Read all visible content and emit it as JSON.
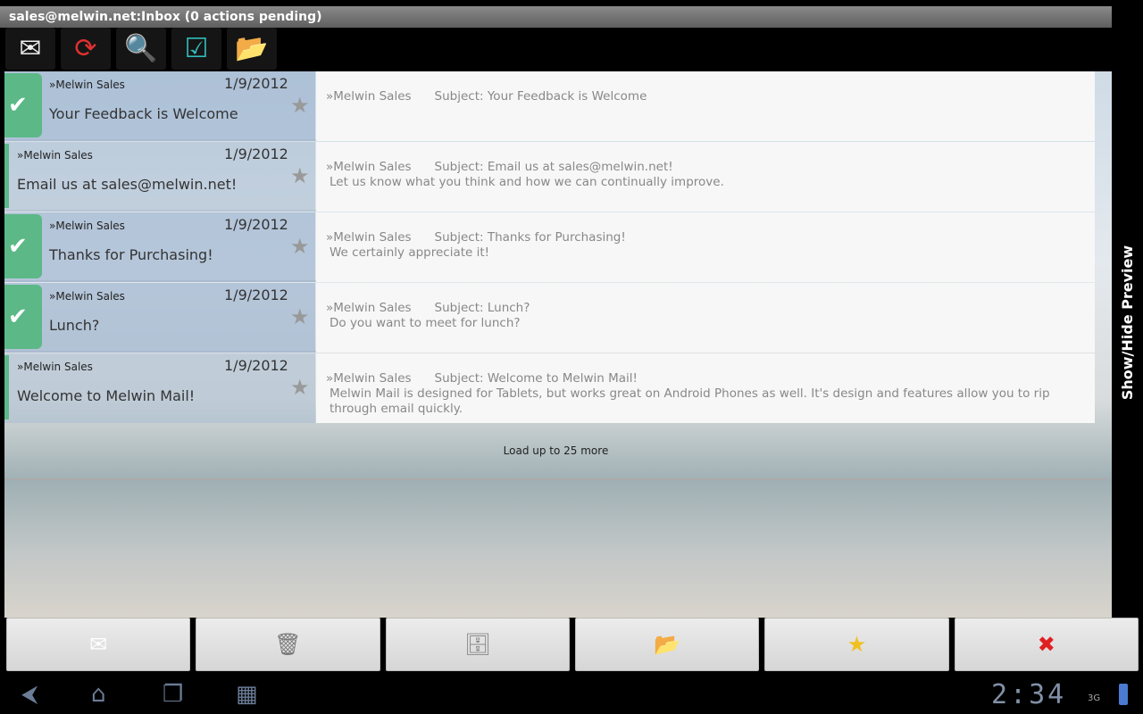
{
  "title": "sales@melwin.net:Inbox (0 actions pending)",
  "toolbar": [
    {
      "name": "compose",
      "icon": "✉"
    },
    {
      "name": "sync",
      "icon": "⟳"
    },
    {
      "name": "search",
      "icon": "🔍"
    },
    {
      "name": "select-list",
      "icon": "☑"
    },
    {
      "name": "folders",
      "icon": "📂"
    }
  ],
  "messages": [
    {
      "from": "»Melwin Sales",
      "date": "1/9/2012",
      "subject": "Your Feedback is Welcome",
      "checked": true,
      "preview_from": "»Melwin Sales",
      "preview_subject": "Subject: Your Feedback is Welcome",
      "body": ""
    },
    {
      "from": "»Melwin Sales",
      "date": "1/9/2012",
      "subject": "Email us at sales@melwin.net!",
      "checked": false,
      "preview_from": "»Melwin Sales",
      "preview_subject": "Subject: Email us at sales@melwin.net!",
      "body": "Let us know what you think and how we can continually improve."
    },
    {
      "from": "»Melwin Sales",
      "date": "1/9/2012",
      "subject": "Thanks for Purchasing!",
      "checked": true,
      "preview_from": "»Melwin Sales",
      "preview_subject": "Subject: Thanks for Purchasing!",
      "body": "We certainly appreciate it!"
    },
    {
      "from": "»Melwin Sales",
      "date": "1/9/2012",
      "subject": "Lunch?",
      "checked": true,
      "preview_from": "»Melwin Sales",
      "preview_subject": "Subject: Lunch?",
      "body": "Do you want to meet for lunch?"
    },
    {
      "from": "»Melwin Sales",
      "date": "1/9/2012",
      "subject": "Welcome to Melwin Mail!",
      "checked": false,
      "preview_from": "»Melwin Sales",
      "preview_subject": "Subject: Welcome to Melwin Mail!",
      "body": "Melwin Mail is designed for Tablets, but works great on Android Phones as well. It's design and features allow you to rip through email quickly."
    }
  ],
  "load_more": "Load up to 25 more",
  "preview_toggle": "Show/Hide Preview",
  "actions": [
    {
      "name": "mark-read",
      "icon": "✉"
    },
    {
      "name": "delete",
      "icon": "🗑"
    },
    {
      "name": "archive",
      "icon": "🗄"
    },
    {
      "name": "move",
      "icon": "📂"
    },
    {
      "name": "star",
      "icon": "★"
    },
    {
      "name": "cancel",
      "icon": "✖"
    }
  ],
  "status": {
    "time": "2:34",
    "network": "3G"
  }
}
